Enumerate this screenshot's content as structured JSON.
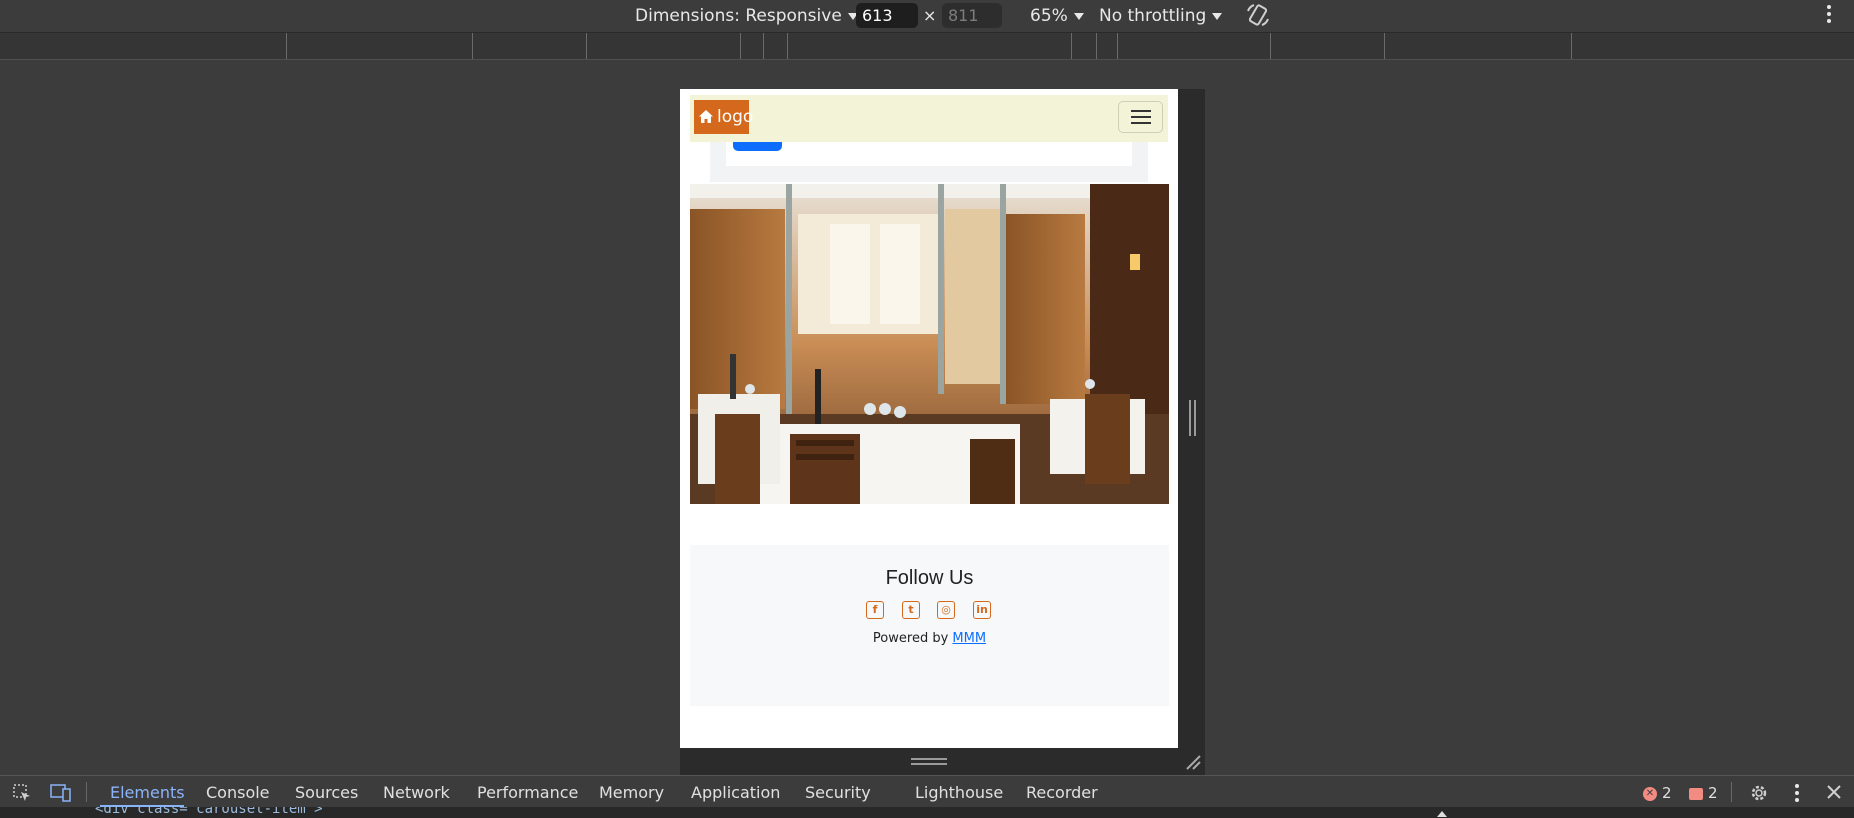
{
  "toolbar": {
    "dimensions_label": "Dimensions: Responsive",
    "width_value": "613",
    "times": "×",
    "height_placeholder": "811",
    "zoom": "65%",
    "throttling": "No throttling"
  },
  "page": {
    "logo_text": "logo",
    "footer": {
      "heading": "Follow Us",
      "social": [
        {
          "icon": "facebook-icon",
          "glyph": "f"
        },
        {
          "icon": "twitter-icon",
          "glyph": "t"
        },
        {
          "icon": "instagram-icon",
          "glyph": "◎"
        },
        {
          "icon": "linkedin-icon",
          "glyph": "in"
        }
      ],
      "powered_by": "Powered by",
      "powered_link": "MMM"
    }
  },
  "devtools": {
    "tabs": [
      "Elements",
      "Console",
      "Sources",
      "Network",
      "Performance",
      "Memory",
      "Application",
      "Security",
      "Lighthouse",
      "Recorder"
    ],
    "errors": "2",
    "warnings": "2",
    "code_snippet": "<div class=\"carousel-item\">"
  },
  "colors": {
    "brand": "#d4691e",
    "navbar_bg": "#f3f3d8",
    "link": "#0d6efd",
    "devtools_accent": "#8ab4f8"
  }
}
